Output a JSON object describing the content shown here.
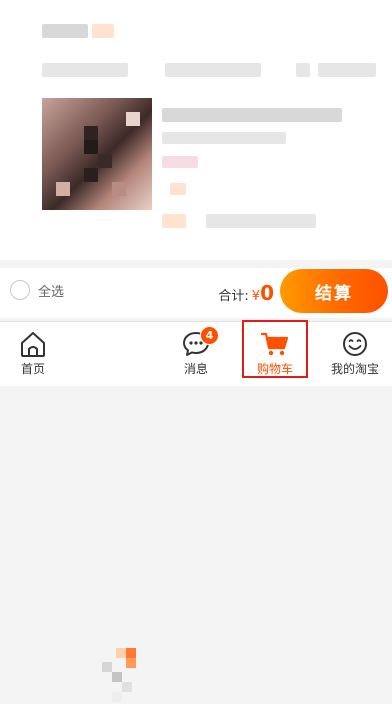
{
  "cart_item": {
    "placeholder_note": ""
  },
  "checkout": {
    "select_all_label": "全选",
    "total_label": "合计:",
    "currency": "¥",
    "total_amount": "0",
    "checkout_label": "结算"
  },
  "tabbar": {
    "tabs": [
      {
        "label": "首页",
        "icon": "home-icon"
      },
      {
        "label": "",
        "icon": "promo-icon"
      },
      {
        "label": "消息",
        "icon": "message-icon",
        "badge": "4"
      },
      {
        "label": "购物车",
        "icon": "cart-icon"
      },
      {
        "label": "我的淘宝",
        "icon": "profile-icon"
      }
    ]
  },
  "colors": {
    "accent": "#ff5000",
    "highlight_frame": "#e21b1b"
  }
}
